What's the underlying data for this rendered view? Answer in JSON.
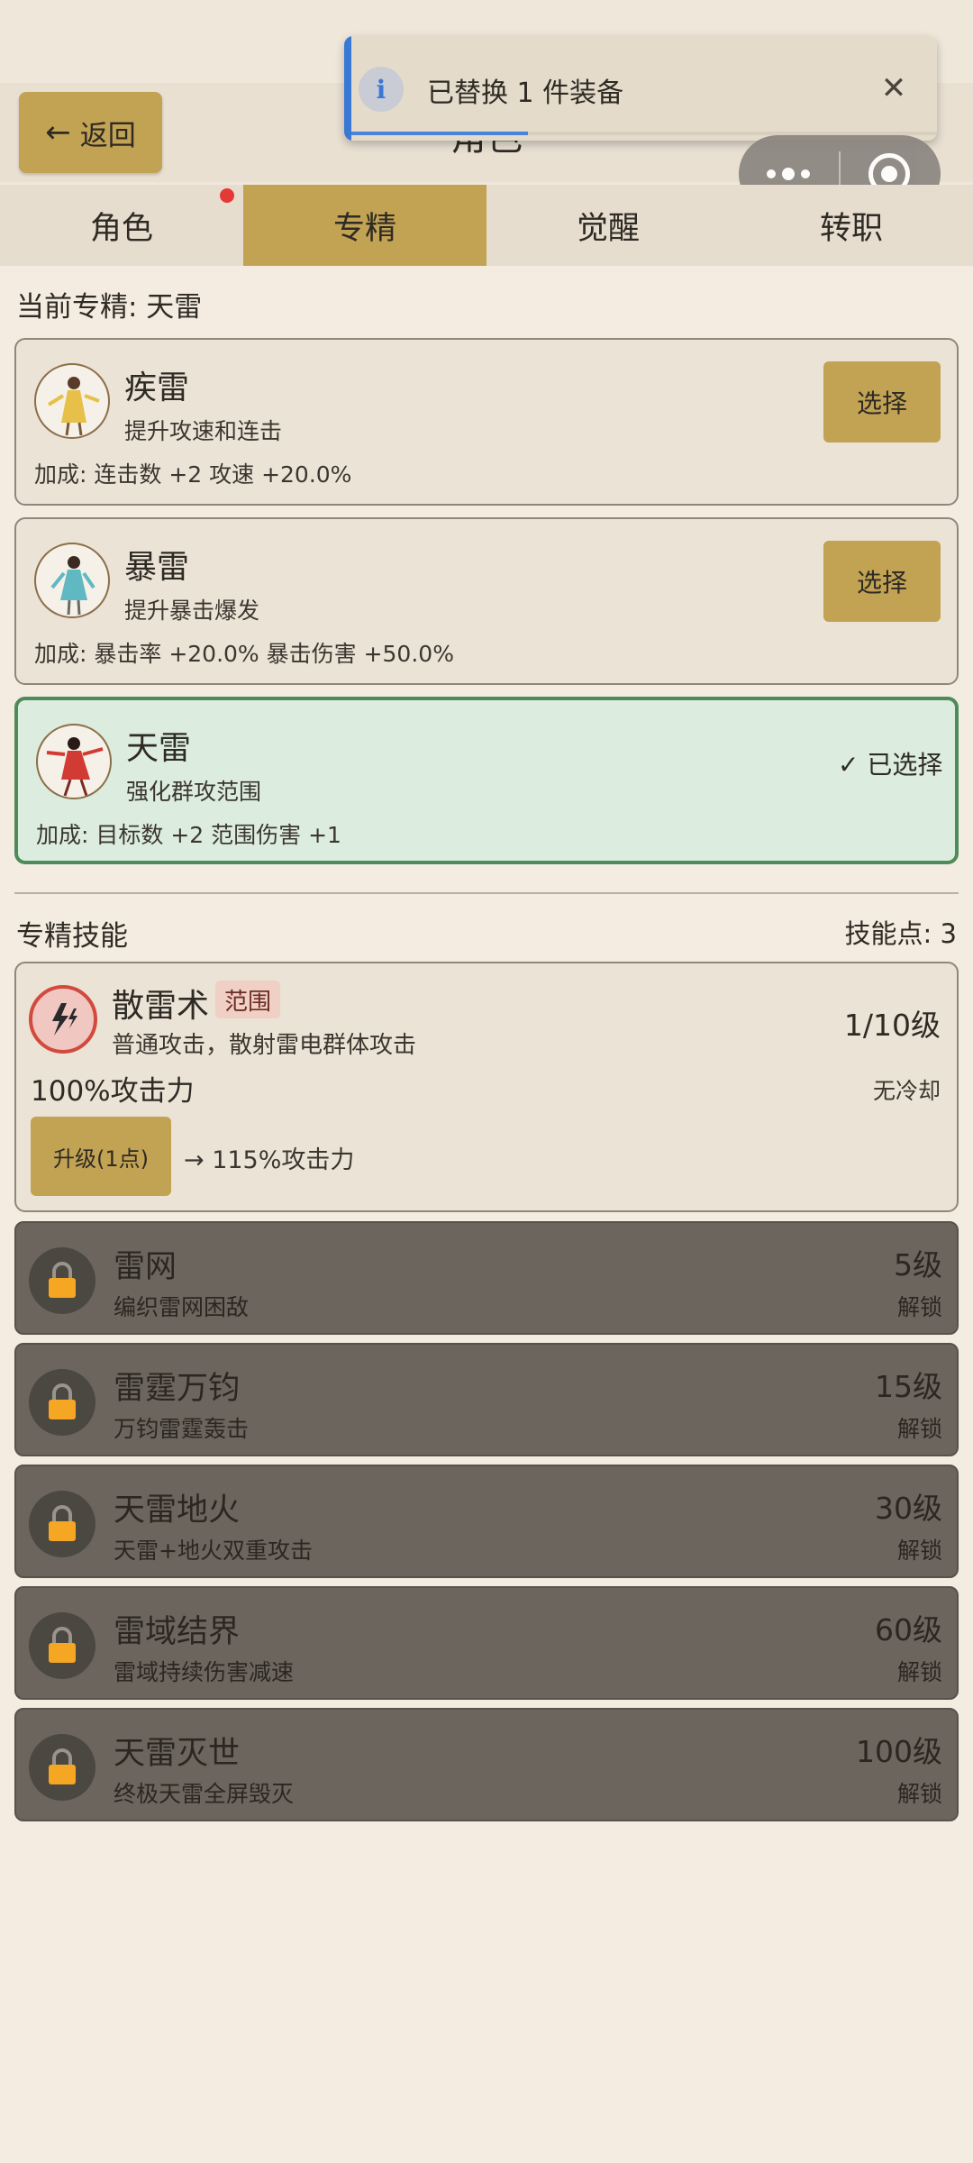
{
  "header": {
    "back_label": "返回",
    "title": "角色"
  },
  "toast": {
    "icon": "info-icon",
    "message": "已替换 1 件装备",
    "progress": 0.3
  },
  "tabs": [
    {
      "label": "角色",
      "has_dot": true
    },
    {
      "label": "专精",
      "active": true
    },
    {
      "label": "觉醒"
    },
    {
      "label": "转职"
    }
  ],
  "current_spec_label": "当前专精: 天雷",
  "specs": [
    {
      "name": "疾雷",
      "desc": "提升攻速和连击",
      "bonus": "加成: 连击数 +2  攻速 +20.0%",
      "action": "选择",
      "color": "#e7c04a"
    },
    {
      "name": "暴雷",
      "desc": "提升暴击爆发",
      "bonus": "加成: 暴击率 +20.0%  暴击伤害 +50.0%",
      "action": "选择",
      "color": "#5fb8c2"
    },
    {
      "name": "天雷",
      "desc": "强化群攻范围",
      "bonus": "加成: 目标数 +2  范围伤害 +1",
      "action": "✓ 已选择",
      "color": "#d23a34"
    }
  ],
  "skills_section": {
    "title": "专精技能",
    "points": "技能点: 3"
  },
  "active_skill": {
    "name": "散雷术",
    "tag": "范围",
    "level": "1/10级",
    "desc": "普通攻击，散射雷电群体攻击",
    "power": "100%攻击力",
    "cooldown": "无冷却",
    "upgrade_label": "升级(1点)",
    "upgrade_preview": "→ 115%攻击力"
  },
  "locked_skills": [
    {
      "name": "雷网",
      "desc": "编织雷网困敌",
      "level": "5级",
      "unlock": "解锁"
    },
    {
      "name": "雷霆万钧",
      "desc": "万钧雷霆轰击",
      "level": "15级",
      "unlock": "解锁"
    },
    {
      "name": "天雷地火",
      "desc": "天雷+地火双重攻击",
      "level": "30级",
      "unlock": "解锁"
    },
    {
      "name": "雷域结界",
      "desc": "雷域持续伤害减速",
      "level": "60级",
      "unlock": "解锁"
    },
    {
      "name": "天雷灭世",
      "desc": "终极天雷全屏毁灭",
      "level": "100级",
      "unlock": "解锁"
    }
  ],
  "colors": {
    "accent": "#c2a253",
    "selected_bg": "#dceddf",
    "selected_border": "#4f8a5b",
    "locked_bg": "#6b655d",
    "toast_accent": "#3a78d6",
    "lock": "#f5a623"
  }
}
